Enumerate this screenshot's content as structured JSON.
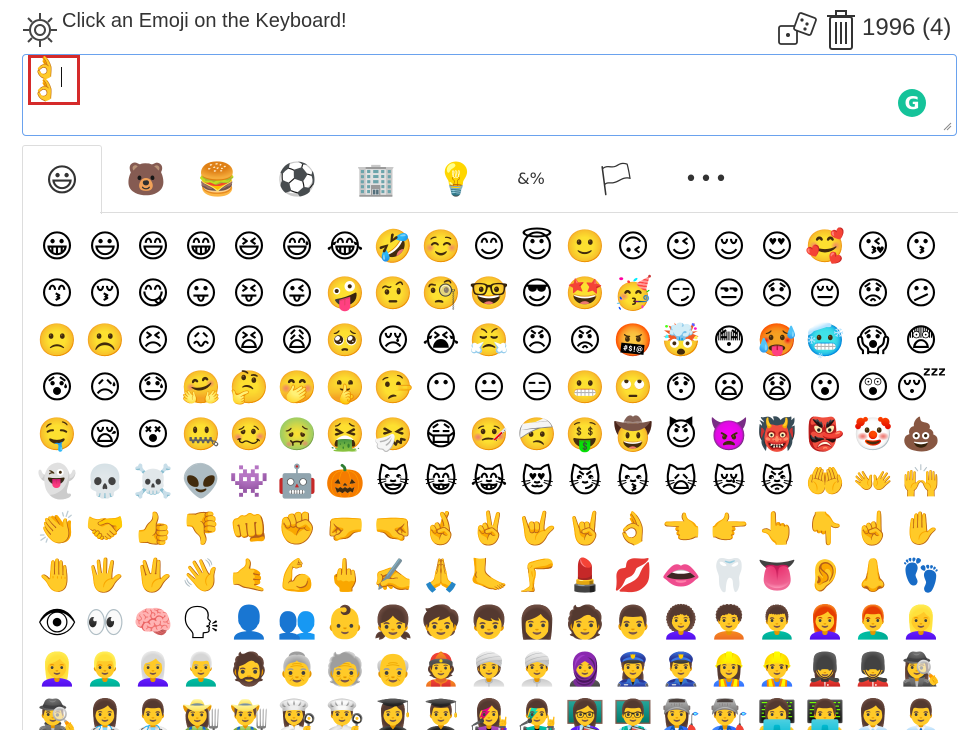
{
  "header": {
    "title": "Click an Emoji on the Keyboard!",
    "count": "1996 (4)"
  },
  "text_area": {
    "value": "👌👌"
  },
  "tabs": [
    {
      "name": "smileys",
      "icon": "😃"
    },
    {
      "name": "animals",
      "icon": "🐻"
    },
    {
      "name": "food",
      "icon": "🍔"
    },
    {
      "name": "activities",
      "icon": "⚽"
    },
    {
      "name": "travel",
      "icon": "🏢"
    },
    {
      "name": "objects",
      "icon": "💡"
    },
    {
      "name": "symbols",
      "icon": "&%"
    },
    {
      "name": "flags",
      "icon": "🏳"
    },
    {
      "name": "more",
      "icon": "•••"
    }
  ],
  "emoji_grid": [
    [
      "😀",
      "😃",
      "😄",
      "😁",
      "😆",
      "😅",
      "😂",
      "🤣",
      "☺️",
      "😊",
      "😇",
      "🙂",
      "🙃",
      "😉",
      "😌",
      "😍",
      "🥰",
      "😘",
      "😗"
    ],
    [
      "😙",
      "😚",
      "😋",
      "😛",
      "😝",
      "😜",
      "🤪",
      "🤨",
      "🧐",
      "🤓",
      "😎",
      "🤩",
      "🥳",
      "😏",
      "😒",
      "😞",
      "😔",
      "😟",
      "😕"
    ],
    [
      "🙁",
      "☹️",
      "😣",
      "😖",
      "😫",
      "😩",
      "🥺",
      "😢",
      "😭",
      "😤",
      "😠",
      "😡",
      "🤬",
      "🤯",
      "😳",
      "🥵",
      "🥶",
      "😱",
      "😨"
    ],
    [
      "😰",
      "😥",
      "😓",
      "🤗",
      "🤔",
      "🤭",
      "🤫",
      "🤥",
      "😶",
      "😐",
      "😑",
      "😬",
      "🙄",
      "😯",
      "😦",
      "😧",
      "😮",
      "😲",
      "😴"
    ],
    [
      "🤤",
      "😪",
      "😵",
      "🤐",
      "🥴",
      "🤢",
      "🤮",
      "🤧",
      "😷",
      "🤒",
      "🤕",
      "🤑",
      "🤠",
      "😈",
      "👿",
      "👹",
      "👺",
      "🤡",
      "💩"
    ],
    [
      "👻",
      "💀",
      "☠️",
      "👽",
      "👾",
      "🤖",
      "🎃",
      "😺",
      "😸",
      "😹",
      "😻",
      "😼",
      "😽",
      "🙀",
      "😿",
      "😾",
      "🤲",
      "👐",
      "🙌"
    ],
    [
      "👏",
      "🤝",
      "👍",
      "👎",
      "👊",
      "✊",
      "🤛",
      "🤜",
      "🤞",
      "✌️",
      "🤟",
      "🤘",
      "👌",
      "👈",
      "👉",
      "👆",
      "👇",
      "☝️",
      "✋"
    ],
    [
      "🤚",
      "🖐",
      "🖖",
      "👋",
      "🤙",
      "💪",
      "🖕",
      "✍️",
      "🙏",
      "🦶",
      "🦵",
      "💄",
      "💋",
      "👄",
      "🦷",
      "👅",
      "👂",
      "👃",
      "👣"
    ],
    [
      "👁",
      "👀",
      "🧠",
      "🗣",
      "👤",
      "👥",
      "👶",
      "👧",
      "🧒",
      "👦",
      "👩",
      "🧑",
      "👨",
      "👩‍🦱",
      "🧑‍🦱",
      "👨‍🦱",
      "👩‍🦰",
      "👨‍🦰",
      "👱‍♀️"
    ],
    [
      "👱‍♀️",
      "👱‍♂️",
      "👩‍🦳",
      "👨‍🦳",
      "🧔",
      "👵",
      "🧓",
      "👴",
      "👲",
      "👳‍♀️",
      "👳‍♂️",
      "🧕",
      "👮‍♀️",
      "👮‍♂️",
      "👷‍♀️",
      "👷‍♂️",
      "💂‍♀️",
      "💂‍♂️",
      "🕵️‍♀️"
    ],
    [
      "🕵️‍♂️",
      "👩‍⚕️",
      "👨‍⚕️",
      "👩‍🌾",
      "👨‍🌾",
      "👩‍🍳",
      "👨‍🍳",
      "👩‍🎓",
      "👨‍🎓",
      "👩‍🎤",
      "👨‍🎤",
      "👩‍🏫",
      "👨‍🏫",
      "👩‍🏭",
      "👨‍🏭",
      "👩‍💻",
      "👨‍💻",
      "👩‍💼",
      "👨‍💼"
    ]
  ]
}
